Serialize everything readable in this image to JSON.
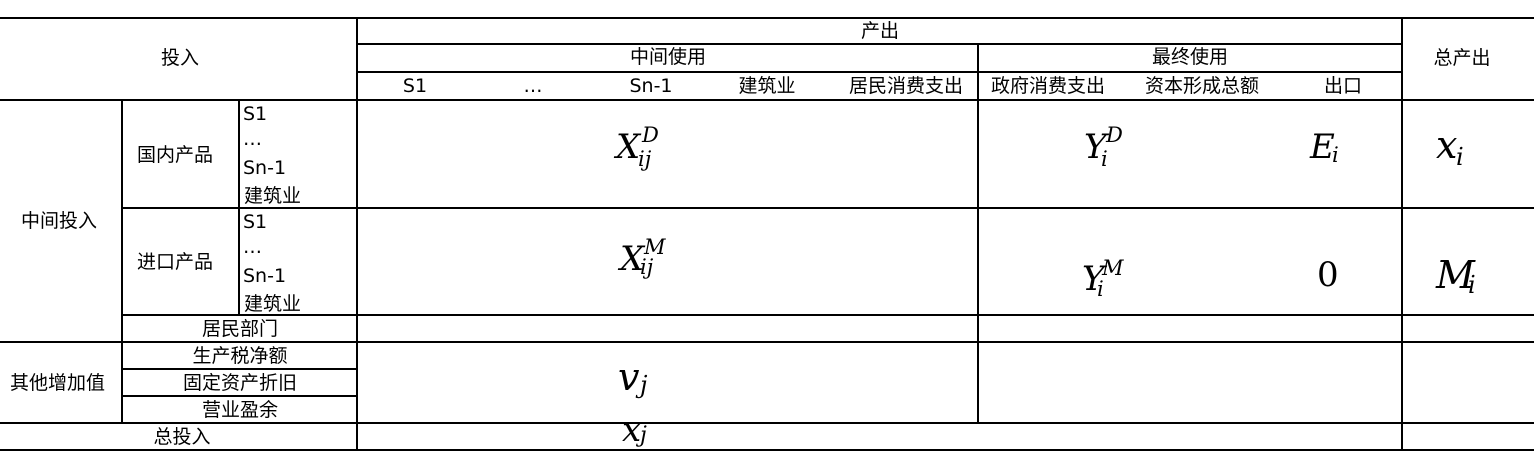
{
  "header": {
    "input": "投入",
    "output": "产出",
    "intermediate_use": "中间使用",
    "final_use": "最终使用",
    "total_output": "总产出",
    "columns": [
      "S1",
      "…",
      "Sn-1",
      "建筑业",
      "居民消费支出",
      "政府消费支出",
      "资本形成总额",
      "出口"
    ]
  },
  "rows": {
    "intermediate_input": "中间投入",
    "domestic": "国内产品",
    "imported": "进口产品",
    "sectors": [
      "S1",
      "…",
      "Sn-1",
      "建筑业"
    ],
    "households": "居民部门",
    "other_value_added": "其他增加值",
    "value_added_items": [
      "生产税净额",
      "固定资产折旧",
      "营业盈余"
    ],
    "total_input": "总投入"
  },
  "math": {
    "X": "X",
    "Y": "Y",
    "E": "E",
    "M": "M",
    "x": "x",
    "v": "v",
    "sup_D": "D",
    "sup_M": "M",
    "sub_ij": "ij",
    "sub_i": "i",
    "sub_j": "j",
    "zero": "0"
  }
}
